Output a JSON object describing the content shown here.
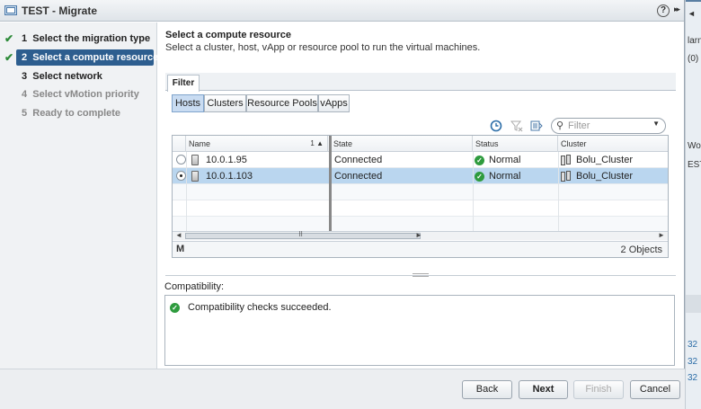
{
  "window": {
    "title": "TEST - Migrate",
    "help": "?",
    "expand": "▸▸"
  },
  "steps": [
    {
      "num": "1",
      "label": "Select the migration type",
      "state": "done"
    },
    {
      "num": "2",
      "label": "Select a compute resource",
      "state": "active"
    },
    {
      "num": "3",
      "label": "Select network",
      "state": "next"
    },
    {
      "num": "4",
      "label": "Select vMotion priority",
      "state": "future"
    },
    {
      "num": "5",
      "label": "Ready to complete",
      "state": "future"
    }
  ],
  "header": {
    "title": "Select a compute resource",
    "subtitle": "Select a cluster, host, vApp or resource pool to run the virtual machines."
  },
  "filter_tab": "Filter",
  "segments": [
    {
      "label": "Hosts",
      "selected": true
    },
    {
      "label": "Clusters",
      "selected": false
    },
    {
      "label": "Resource Pools",
      "selected": false
    },
    {
      "label": "vApps",
      "selected": false
    }
  ],
  "search": {
    "placeholder": "Filter"
  },
  "grid": {
    "columns": {
      "name": "Name",
      "sort": "1 ▲",
      "state": "State",
      "status": "Status",
      "cluster": "Cluster"
    },
    "rows": [
      {
        "name": "10.0.1.95",
        "state": "Connected",
        "status": "Normal",
        "cluster": "Bolu_Cluster",
        "selected": false
      },
      {
        "name": "10.0.1.103",
        "state": "Connected",
        "status": "Normal",
        "cluster": "Bolu_Cluster",
        "selected": true
      }
    ],
    "object_count": "2 Objects",
    "scroll_grip": "⠿"
  },
  "compatibility": {
    "label": "Compatibility:",
    "message": "Compatibility checks succeeded."
  },
  "buttons": {
    "back": "Back",
    "next": "Next",
    "finish": "Finish",
    "cancel": "Cancel"
  },
  "background": {
    "alarms": "larn",
    "count": "(0)",
    "work": "Worl",
    "test": "EST",
    "nums": [
      "32",
      "32",
      "32"
    ]
  },
  "colors": {
    "accent": "#2d5e8f",
    "selected_row": "#bad6ef",
    "ok_green": "#2e9b3e"
  }
}
